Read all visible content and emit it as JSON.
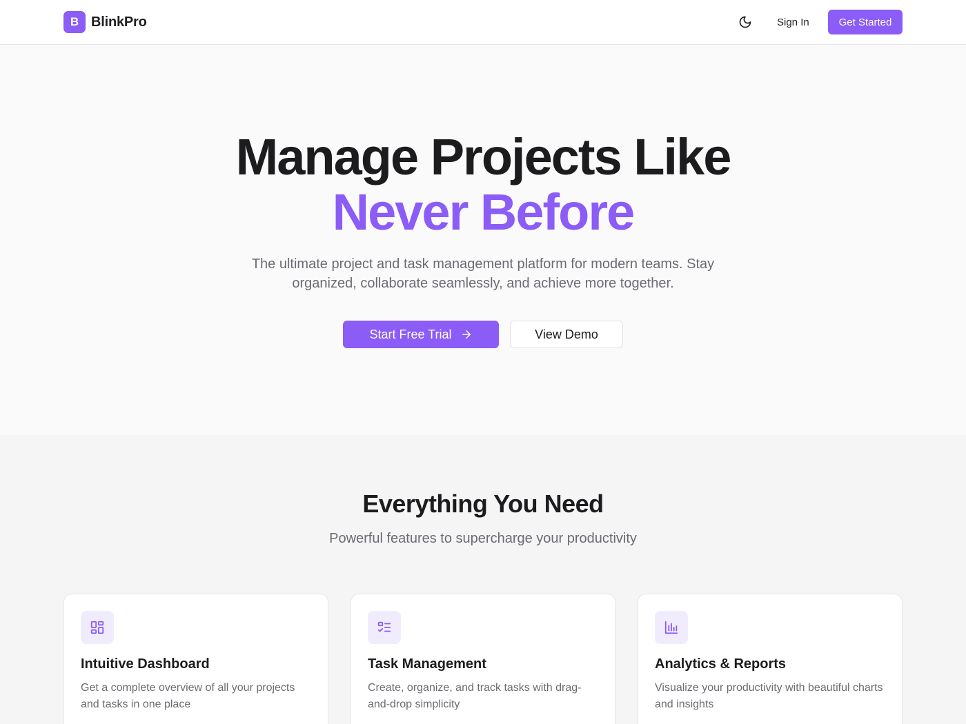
{
  "brand": {
    "logo_letter": "B",
    "name": "BlinkPro",
    "accent_color": "#8b5cf6"
  },
  "header": {
    "theme_icon": "moon-icon",
    "sign_in_label": "Sign In",
    "get_started_label": "Get Started"
  },
  "hero": {
    "title_line1": "Manage Projects Like",
    "title_line2": "Never Before",
    "subtitle": "The ultimate project and task management platform for modern teams. Stay organized, collaborate seamlessly, and achieve more together.",
    "primary_cta": "Start Free Trial",
    "primary_cta_icon": "arrow-right-icon",
    "secondary_cta": "View Demo"
  },
  "features": {
    "title": "Everything You Need",
    "subtitle": "Powerful features to supercharge your productivity",
    "cards": [
      {
        "icon": "dashboard-icon",
        "title": "Intuitive Dashboard",
        "description": "Get a complete overview of all your projects and tasks in one place"
      },
      {
        "icon": "task-list-icon",
        "title": "Task Management",
        "description": "Create, organize, and track tasks with drag-and-drop simplicity"
      },
      {
        "icon": "bar-chart-icon",
        "title": "Analytics & Reports",
        "description": "Visualize your productivity with beautiful charts and insights"
      }
    ]
  }
}
